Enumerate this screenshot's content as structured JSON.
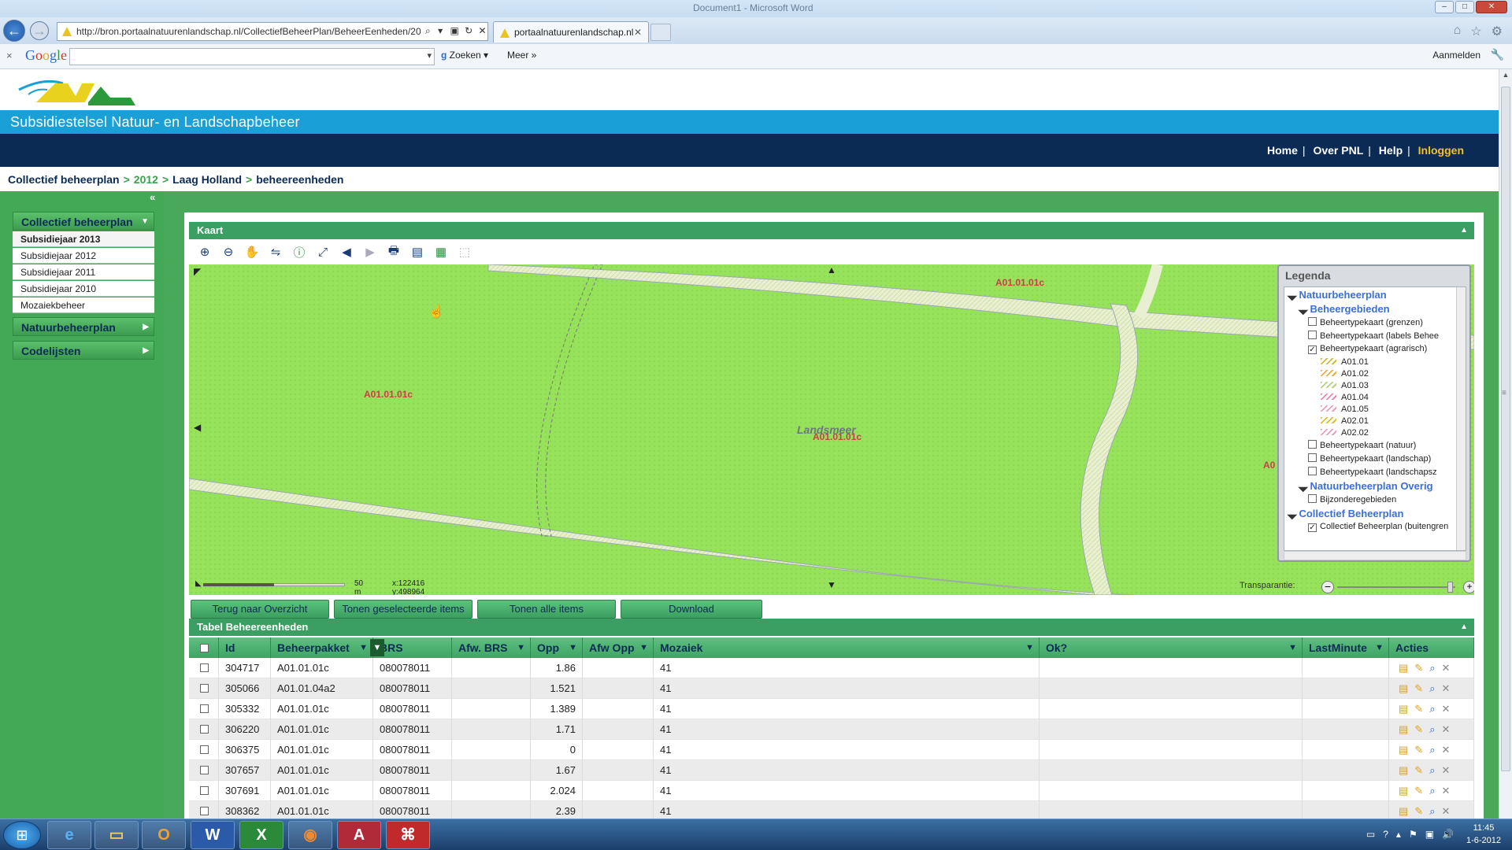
{
  "browser": {
    "window_title": "Document1 - Microsoft Word",
    "address": "http://bron.portaalnatuurenlandschap.nl/CollectiefBeheerPlan/BeheerEenheden/20",
    "tab_title": "portaalnatuurenlandschap.nl",
    "toolbar_google_label": "Google",
    "search_button": "Zoeken",
    "more_button": "Meer",
    "signin": "Aanmelden"
  },
  "site": {
    "title": "Subsidiestelsel Natuur- en Landschapbeheer",
    "nav": [
      "Home",
      "Over PNL",
      "Help",
      "Inloggen"
    ],
    "breadcrumb": [
      "Collectief beheerplan",
      "2012",
      "Laag Holland",
      "beheereenheden"
    ]
  },
  "sidebar": {
    "sections": [
      {
        "label": "Collectief beheerplan",
        "items": [
          "Subsidiejaar 2013",
          "Subsidiejaar 2012",
          "Subsidiejaar 2011",
          "Subsidiejaar 2010",
          "Mozaiekbeheer"
        ]
      },
      {
        "label": "Natuurbeheerplan"
      },
      {
        "label": "Codelijsten"
      }
    ]
  },
  "map_panel": {
    "title": "Kaart",
    "labels": [
      "A01.01.01c",
      "A01.01.01c",
      "A01.01.01c",
      "Landsmeer",
      "A0"
    ],
    "scale": "50 m",
    "coords": "x:122416 y:498964",
    "transparency_label": "Transparantie:",
    "transparency": 0.95,
    "legend": {
      "title": "Legenda",
      "rows": [
        {
          "text": "Natuurbeheerplan",
          "kind": "h1"
        },
        {
          "text": "Beheergebieden",
          "kind": "h2"
        },
        {
          "text": "Beheertypekaart (grenzen)",
          "kind": "chk",
          "checked": false
        },
        {
          "text": "Beheertypekaart (labels Behee",
          "kind": "chk",
          "checked": false
        },
        {
          "text": "Beheertypekaart (agrarisch)",
          "kind": "chk",
          "checked": true
        },
        {
          "text": "A01.01",
          "kind": "sw",
          "color": "#c9c03a"
        },
        {
          "text": "A01.02",
          "kind": "sw",
          "color": "#e6b04a"
        },
        {
          "text": "A01.03",
          "kind": "sw",
          "color": "#b7d080"
        },
        {
          "text": "A01.04",
          "kind": "sw",
          "color": "#e68ab0"
        },
        {
          "text": "A01.05",
          "kind": "sw",
          "color": "#e6a0c0"
        },
        {
          "text": "A02.01",
          "kind": "sw",
          "color": "#d9c030"
        },
        {
          "text": "A02.02",
          "kind": "sw",
          "color": "#e0a0c8"
        },
        {
          "text": "Beheertypekaart (natuur)",
          "kind": "chk",
          "checked": false
        },
        {
          "text": "Beheertypekaart (landschap)",
          "kind": "chk",
          "checked": false
        },
        {
          "text": "Beheertypekaart (landschapsz",
          "kind": "chk",
          "checked": false
        },
        {
          "text": "Natuurbeheerplan Overig",
          "kind": "h2"
        },
        {
          "text": "Bijzonderegebieden",
          "kind": "chk",
          "checked": false
        },
        {
          "text": "Collectief Beheerplan",
          "kind": "h1"
        },
        {
          "text": "Collectief Beheerplan (buitengren",
          "kind": "chk",
          "checked": true
        }
      ]
    }
  },
  "buttons": [
    "Terug naar Overzicht",
    "Tonen geselecteerde items",
    "Tonen alle items",
    "Download"
  ],
  "table": {
    "title": "Tabel Beheereenheden",
    "columns": [
      "",
      "Id",
      "Beheerpakket",
      "BRS",
      "Afw. BRS",
      "Opp",
      "Afw Opp",
      "Mozaiek",
      "Ok?",
      "LastMinute",
      "Acties"
    ],
    "rows": [
      [
        "304717",
        "A01.01.01c",
        "080078011",
        "",
        "1.86",
        "",
        "41",
        "",
        ""
      ],
      [
        "305066",
        "A01.01.04a2",
        "080078011",
        "",
        "1.521",
        "",
        "41",
        "",
        ""
      ],
      [
        "305332",
        "A01.01.01c",
        "080078011",
        "",
        "1.389",
        "",
        "41",
        "",
        ""
      ],
      [
        "306220",
        "A01.01.01c",
        "080078011",
        "",
        "1.71",
        "",
        "41",
        "",
        ""
      ],
      [
        "306375",
        "A01.01.01c",
        "080078011",
        "",
        "0",
        "",
        "41",
        "",
        ""
      ],
      [
        "307657",
        "A01.01.01c",
        "080078011",
        "",
        "1.67",
        "",
        "41",
        "",
        ""
      ],
      [
        "307691",
        "A01.01.01c",
        "080078011",
        "",
        "2.024",
        "",
        "41",
        "",
        ""
      ],
      [
        "308362",
        "A01.01.01c",
        "080078011",
        "",
        "2.39",
        "",
        "41",
        "",
        ""
      ]
    ]
  },
  "taskbar": {
    "apps": [
      "internet-explorer",
      "explorer",
      "outlook",
      "word",
      "excel",
      "firefox",
      "access",
      "acrobat"
    ],
    "time": "11:45",
    "date": "1-6-2012"
  }
}
